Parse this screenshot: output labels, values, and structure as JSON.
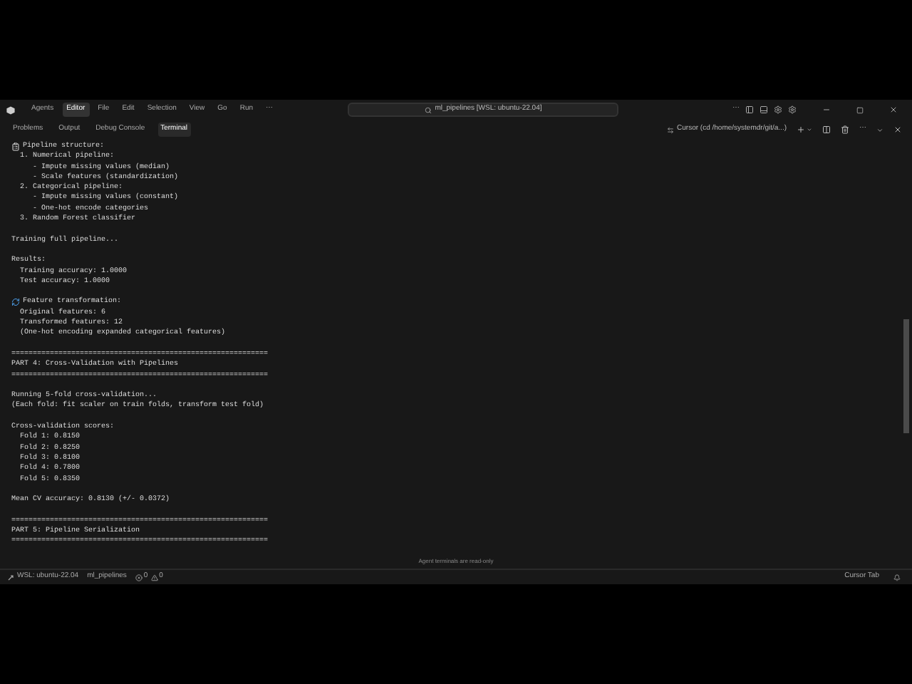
{
  "title_bar": {
    "menu": [
      {
        "label": "Agents",
        "selected": false
      },
      {
        "label": "Editor",
        "selected": true
      },
      {
        "label": "File",
        "selected": false
      },
      {
        "label": "Edit",
        "selected": false
      },
      {
        "label": "Selection",
        "selected": false
      },
      {
        "label": "View",
        "selected": false
      },
      {
        "label": "Go",
        "selected": false
      },
      {
        "label": "Run",
        "selected": false
      }
    ],
    "more": "⋯",
    "search": {
      "value": "ml_pipelines [WSL: ubuntu-22.04]"
    },
    "right_more": "⋯"
  },
  "panel": {
    "tabs": [
      {
        "label": "Problems",
        "selected": false
      },
      {
        "label": "Output",
        "selected": false
      },
      {
        "label": "Debug Console",
        "selected": false
      },
      {
        "label": "Terminal",
        "selected": true
      }
    ],
    "terminal_name": "Cursor (cd /home/systemdr/git/a...)",
    "more": "⋯"
  },
  "terminal": {
    "lines": [
      {
        "kind": "clipboard",
        "text": "Pipeline structure:"
      },
      {
        "kind": "plain",
        "text": "  1. Numerical pipeline:"
      },
      {
        "kind": "plain",
        "text": "     - Impute missing values (median)"
      },
      {
        "kind": "plain",
        "text": "     - Scale features (standardization)"
      },
      {
        "kind": "plain",
        "text": "  2. Categorical pipeline:"
      },
      {
        "kind": "plain",
        "text": "     - Impute missing values (constant)"
      },
      {
        "kind": "plain",
        "text": "     - One-hot encode categories"
      },
      {
        "kind": "plain",
        "text": "  3. Random Forest classifier"
      },
      {
        "kind": "blank"
      },
      {
        "kind": "plain",
        "text": "Training full pipeline..."
      },
      {
        "kind": "blank"
      },
      {
        "kind": "plain",
        "text": "Results:"
      },
      {
        "kind": "plain",
        "text": "  Training accuracy: 1.0000"
      },
      {
        "kind": "plain",
        "text": "  Test accuracy: 1.0000"
      },
      {
        "kind": "blank"
      },
      {
        "kind": "refresh",
        "text": "Feature transformation:"
      },
      {
        "kind": "plain",
        "text": "  Original features: 6"
      },
      {
        "kind": "plain",
        "text": "  Transformed features: 12"
      },
      {
        "kind": "plain",
        "text": "  (One-hot encoding expanded categorical features)"
      },
      {
        "kind": "blank"
      },
      {
        "kind": "plain",
        "text": "============================================================"
      },
      {
        "kind": "plain",
        "text": "PART 4: Cross-Validation with Pipelines"
      },
      {
        "kind": "plain",
        "text": "============================================================"
      },
      {
        "kind": "blank"
      },
      {
        "kind": "plain",
        "text": "Running 5-fold cross-validation..."
      },
      {
        "kind": "plain",
        "text": "(Each fold: fit scaler on train folds, transform test fold)"
      },
      {
        "kind": "blank"
      },
      {
        "kind": "plain",
        "text": "Cross-validation scores:"
      },
      {
        "kind": "plain",
        "text": "  Fold 1: 0.8150"
      },
      {
        "kind": "plain",
        "text": "  Fold 2: 0.8250"
      },
      {
        "kind": "plain",
        "text": "  Fold 3: 0.8100"
      },
      {
        "kind": "plain",
        "text": "  Fold 4: 0.7800"
      },
      {
        "kind": "plain",
        "text": "  Fold 5: 0.8350"
      },
      {
        "kind": "blank"
      },
      {
        "kind": "plain",
        "text": "Mean CV accuracy: 0.8130 (+/- 0.0372)"
      },
      {
        "kind": "blank"
      },
      {
        "kind": "plain",
        "text": "============================================================"
      },
      {
        "kind": "plain",
        "text": "PART 5: Pipeline Serialization"
      },
      {
        "kind": "plain",
        "text": "============================================================"
      }
    ],
    "notice": "Agent terminals are read-only"
  },
  "status_bar": {
    "remote": "WSL: ubuntu-22.04",
    "folder": "ml_pipelines",
    "errors": "0",
    "warnings": "0",
    "right": "Cursor Tab"
  }
}
